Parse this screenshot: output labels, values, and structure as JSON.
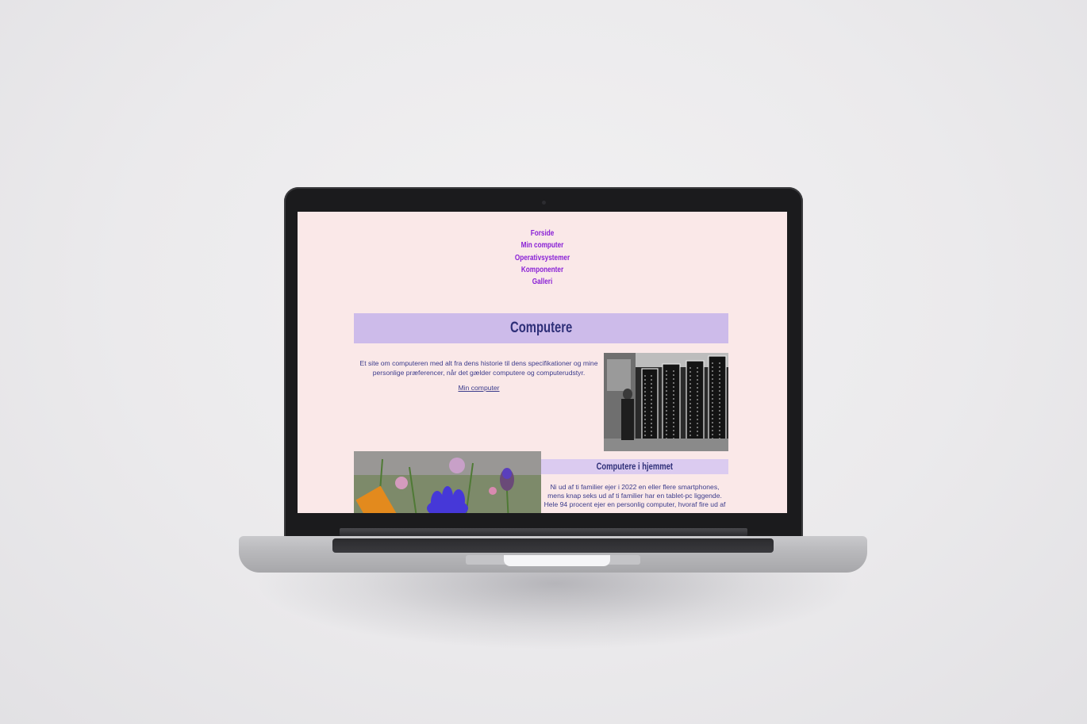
{
  "nav": {
    "items": [
      {
        "label": "Forside"
      },
      {
        "label": "Min computer"
      },
      {
        "label": "Operativsystemer"
      },
      {
        "label": "Komponenter"
      },
      {
        "label": "Galleri"
      }
    ]
  },
  "hero": {
    "title": "Computere",
    "intro": "Et site om computeren med alt fra dens historie til dens specifikationer og mine personlige præferencer, når det gælder computere og computerudstyr.",
    "link_label": "Min computer"
  },
  "section": {
    "title": "Computere i hjemmet",
    "text": "Ni ud af ti familier ejer i 2022 en eller flere smartphones, mens knap seks ud af ti familier har en tablet-pc liggende. Hele 94 procent ejer en personlig computer, hvoraf fire ud af"
  },
  "colors": {
    "page_bg": "#fae8e8",
    "nav_link": "#8a22d6",
    "banner_bg": "#cdbbea",
    "heading": "#2e2f78",
    "text": "#3c3c8c"
  }
}
